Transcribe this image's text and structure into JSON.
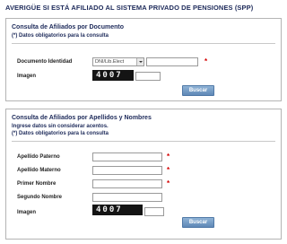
{
  "page": {
    "title": "AVERIGÜE SI ESTÁ AFILIADO AL SISTEMA PRIVADO DE PENSIONES (SPP)"
  },
  "section_document": {
    "heading": "Consulta de Afiliados por Documento",
    "note": "(*) Datos obligatorios para la consulta",
    "fields": {
      "document_label": "Documento Identidad",
      "document_type_selected": "DNI/Lib.Elect",
      "document_number_value": "",
      "image_label": "Imagen",
      "captcha_text": "4007",
      "captcha_answer_value": ""
    },
    "search_label": "Buscar"
  },
  "section_names": {
    "heading": "Consulta de Afiliados por Apellidos y Nombres",
    "instruction": "Ingrese datos sin considerar acentos.",
    "note": "(*) Datos obligatorios para la consulta",
    "fields": {
      "paternal_label": "Apellido Paterno",
      "maternal_label": "Apellido Materno",
      "first_name_label": "Primer Nombre",
      "second_name_label": "Segundo Nombre",
      "image_label": "Imagen",
      "captcha_text": "4007"
    },
    "search_label": "Buscar"
  },
  "required_marker": "*",
  "colors": {
    "heading": "#1d2a5a",
    "required": "#d40000",
    "button": "#6f96c2"
  }
}
